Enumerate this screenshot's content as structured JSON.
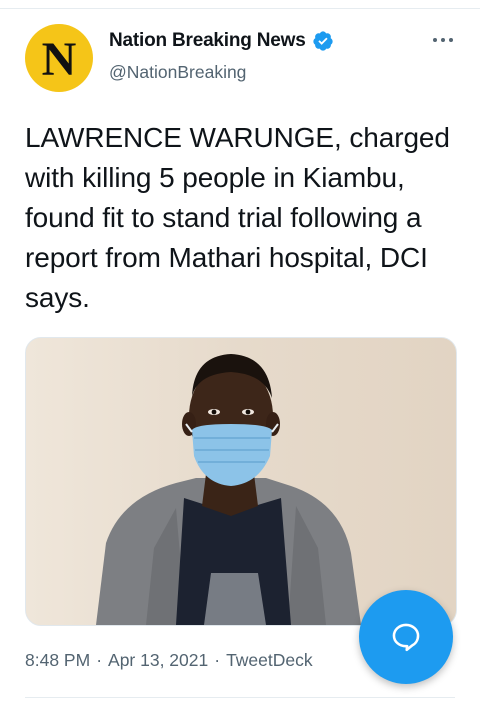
{
  "account": {
    "display_name": "Nation Breaking News",
    "handle": "@NationBreaking",
    "avatar_letter": "N",
    "avatar_color": "#f5c518",
    "verified": true
  },
  "tweet": {
    "text": "LAWRENCE WARUNGE, charged with killing 5 people in Kiambu, found fit to stand trial following a report from Mathari hospital, DCI says.",
    "time": "8:48 PM",
    "date": "Apr 13, 2021",
    "source": "TweetDeck",
    "separator": "·"
  },
  "icons": {
    "more": "more-options-icon",
    "verified": "verified-badge-icon",
    "compose": "compose-reply-icon"
  },
  "colors": {
    "accent": "#1d9bf0",
    "secondary_text": "#536471"
  }
}
